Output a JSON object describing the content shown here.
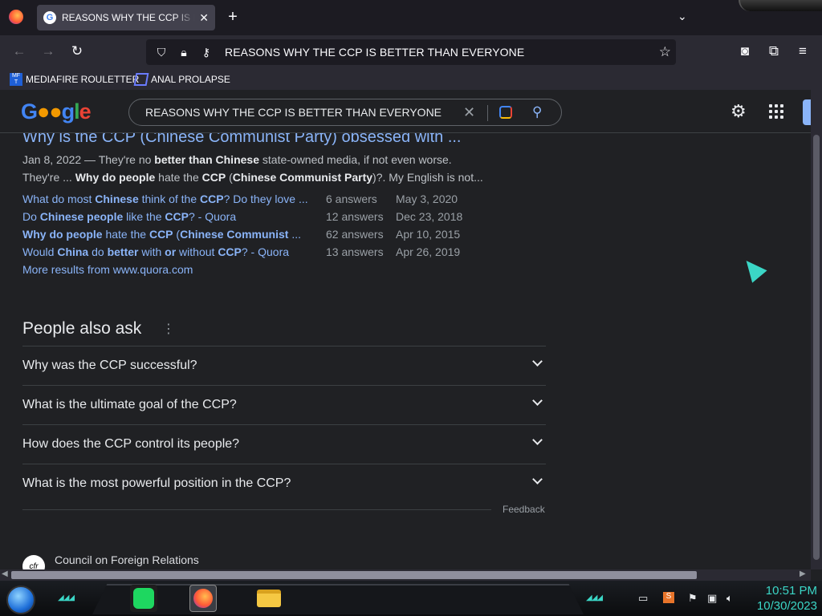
{
  "tabbar": {
    "tab_title": "REASONS WHY THE CCP IS BETTER THAN EVERYONE",
    "tab_favicon": "G",
    "close_glyph": "✕",
    "newtab_glyph": "+",
    "menu_glyph": "⌄"
  },
  "navbar": {
    "back_glyph": "←",
    "forward_glyph": "→",
    "reload_glyph": "↻",
    "url": "REASONS WHY THE CCP IS BETTER THAN EVERYONE",
    "star_glyph": "☆",
    "pocket_glyph": "◙",
    "ext_glyph": "⧉",
    "hamburger_glyph": "≡"
  },
  "bookmarks": [
    {
      "label": "MEDIAFIRE ROULETTER",
      "icon": "mediafire-icon"
    },
    {
      "label": "ANAL PROLAPSE",
      "icon": "bookmark-folder-icon"
    }
  ],
  "google": {
    "logo_text": "Google",
    "search_value": "REASONS WHY THE CCP IS BETTER THAN EVERYONE",
    "clear_glyph": "✕",
    "search_glyph": "⚲",
    "gear_glyph": "⚙"
  },
  "result": {
    "title": "Why is the CCP (Chinese Communist Party) obsessed with ...",
    "snippet_line1": [
      {
        "t": "Jan 8, 2022 — They're no ",
        "b": false
      },
      {
        "t": "better than Chinese",
        "b": true
      },
      {
        "t": " state-owned media, if not even worse.",
        "b": false
      }
    ],
    "snippet_line2": [
      {
        "t": "They're ... ",
        "b": false
      },
      {
        "t": "Why do people",
        "b": true
      },
      {
        "t": " hate the ",
        "b": false
      },
      {
        "t": "CCP",
        "b": true
      },
      {
        "t": " (",
        "b": false
      },
      {
        "t": "Chinese Communist Party",
        "b": true
      },
      {
        "t": ")?. My English is not...",
        "b": false
      }
    ],
    "sub_results": [
      {
        "q": [
          {
            "t": "What do most ",
            "b": false
          },
          {
            "t": "Chinese",
            "b": true
          },
          {
            "t": " think of the ",
            "b": false
          },
          {
            "t": "CCP",
            "b": true
          },
          {
            "t": "? Do they love ...",
            "b": false
          }
        ],
        "answers": "6 answers",
        "date": "May 3, 2020"
      },
      {
        "q": [
          {
            "t": "Do ",
            "b": false
          },
          {
            "t": "Chinese people",
            "b": true
          },
          {
            "t": " like the ",
            "b": false
          },
          {
            "t": "CCP",
            "b": true
          },
          {
            "t": "? - Quora",
            "b": false
          }
        ],
        "answers": "12 answers",
        "date": "Dec 23, 2018"
      },
      {
        "q": [
          {
            "t": "Why do people",
            "b": true
          },
          {
            "t": " hate the ",
            "b": false
          },
          {
            "t": "CCP",
            "b": true
          },
          {
            "t": " (",
            "b": false
          },
          {
            "t": "Chinese Communist",
            "b": true
          },
          {
            "t": " ...",
            "b": false
          }
        ],
        "answers": "62 answers",
        "date": "Apr 10, 2015"
      },
      {
        "q": [
          {
            "t": "Would ",
            "b": false
          },
          {
            "t": "China",
            "b": true
          },
          {
            "t": " do ",
            "b": false
          },
          {
            "t": "better",
            "b": true
          },
          {
            "t": " with ",
            "b": false
          },
          {
            "t": "or",
            "b": true
          },
          {
            "t": " without ",
            "b": false
          },
          {
            "t": "CCP",
            "b": true
          },
          {
            "t": "? - Quora",
            "b": false
          }
        ],
        "answers": "13 answers",
        "date": "Apr 26, 2019"
      }
    ],
    "more_results": "More results from www.quora.com"
  },
  "paa": {
    "title": "People also ask",
    "dots_glyph": "⋮",
    "questions": [
      "Why was the CCP successful?",
      "What is the ultimate goal of the CCP?",
      "How does the CCP control its people?",
      "What is the most powerful position in the CCP?"
    ],
    "feedback": "Feedback"
  },
  "next_result": {
    "logo_text": "cfr",
    "source_name": "Council on Foreign Relations"
  },
  "taskbar": {
    "time": "10:51 PM",
    "date": "10/30/2023",
    "tray_icons": [
      "sublime-icon",
      "flag-icon",
      "network-icon",
      "volume-icon"
    ]
  },
  "colors": {
    "link": "#8ab4f8",
    "background": "#202124",
    "accent": "#3bd6c6"
  }
}
